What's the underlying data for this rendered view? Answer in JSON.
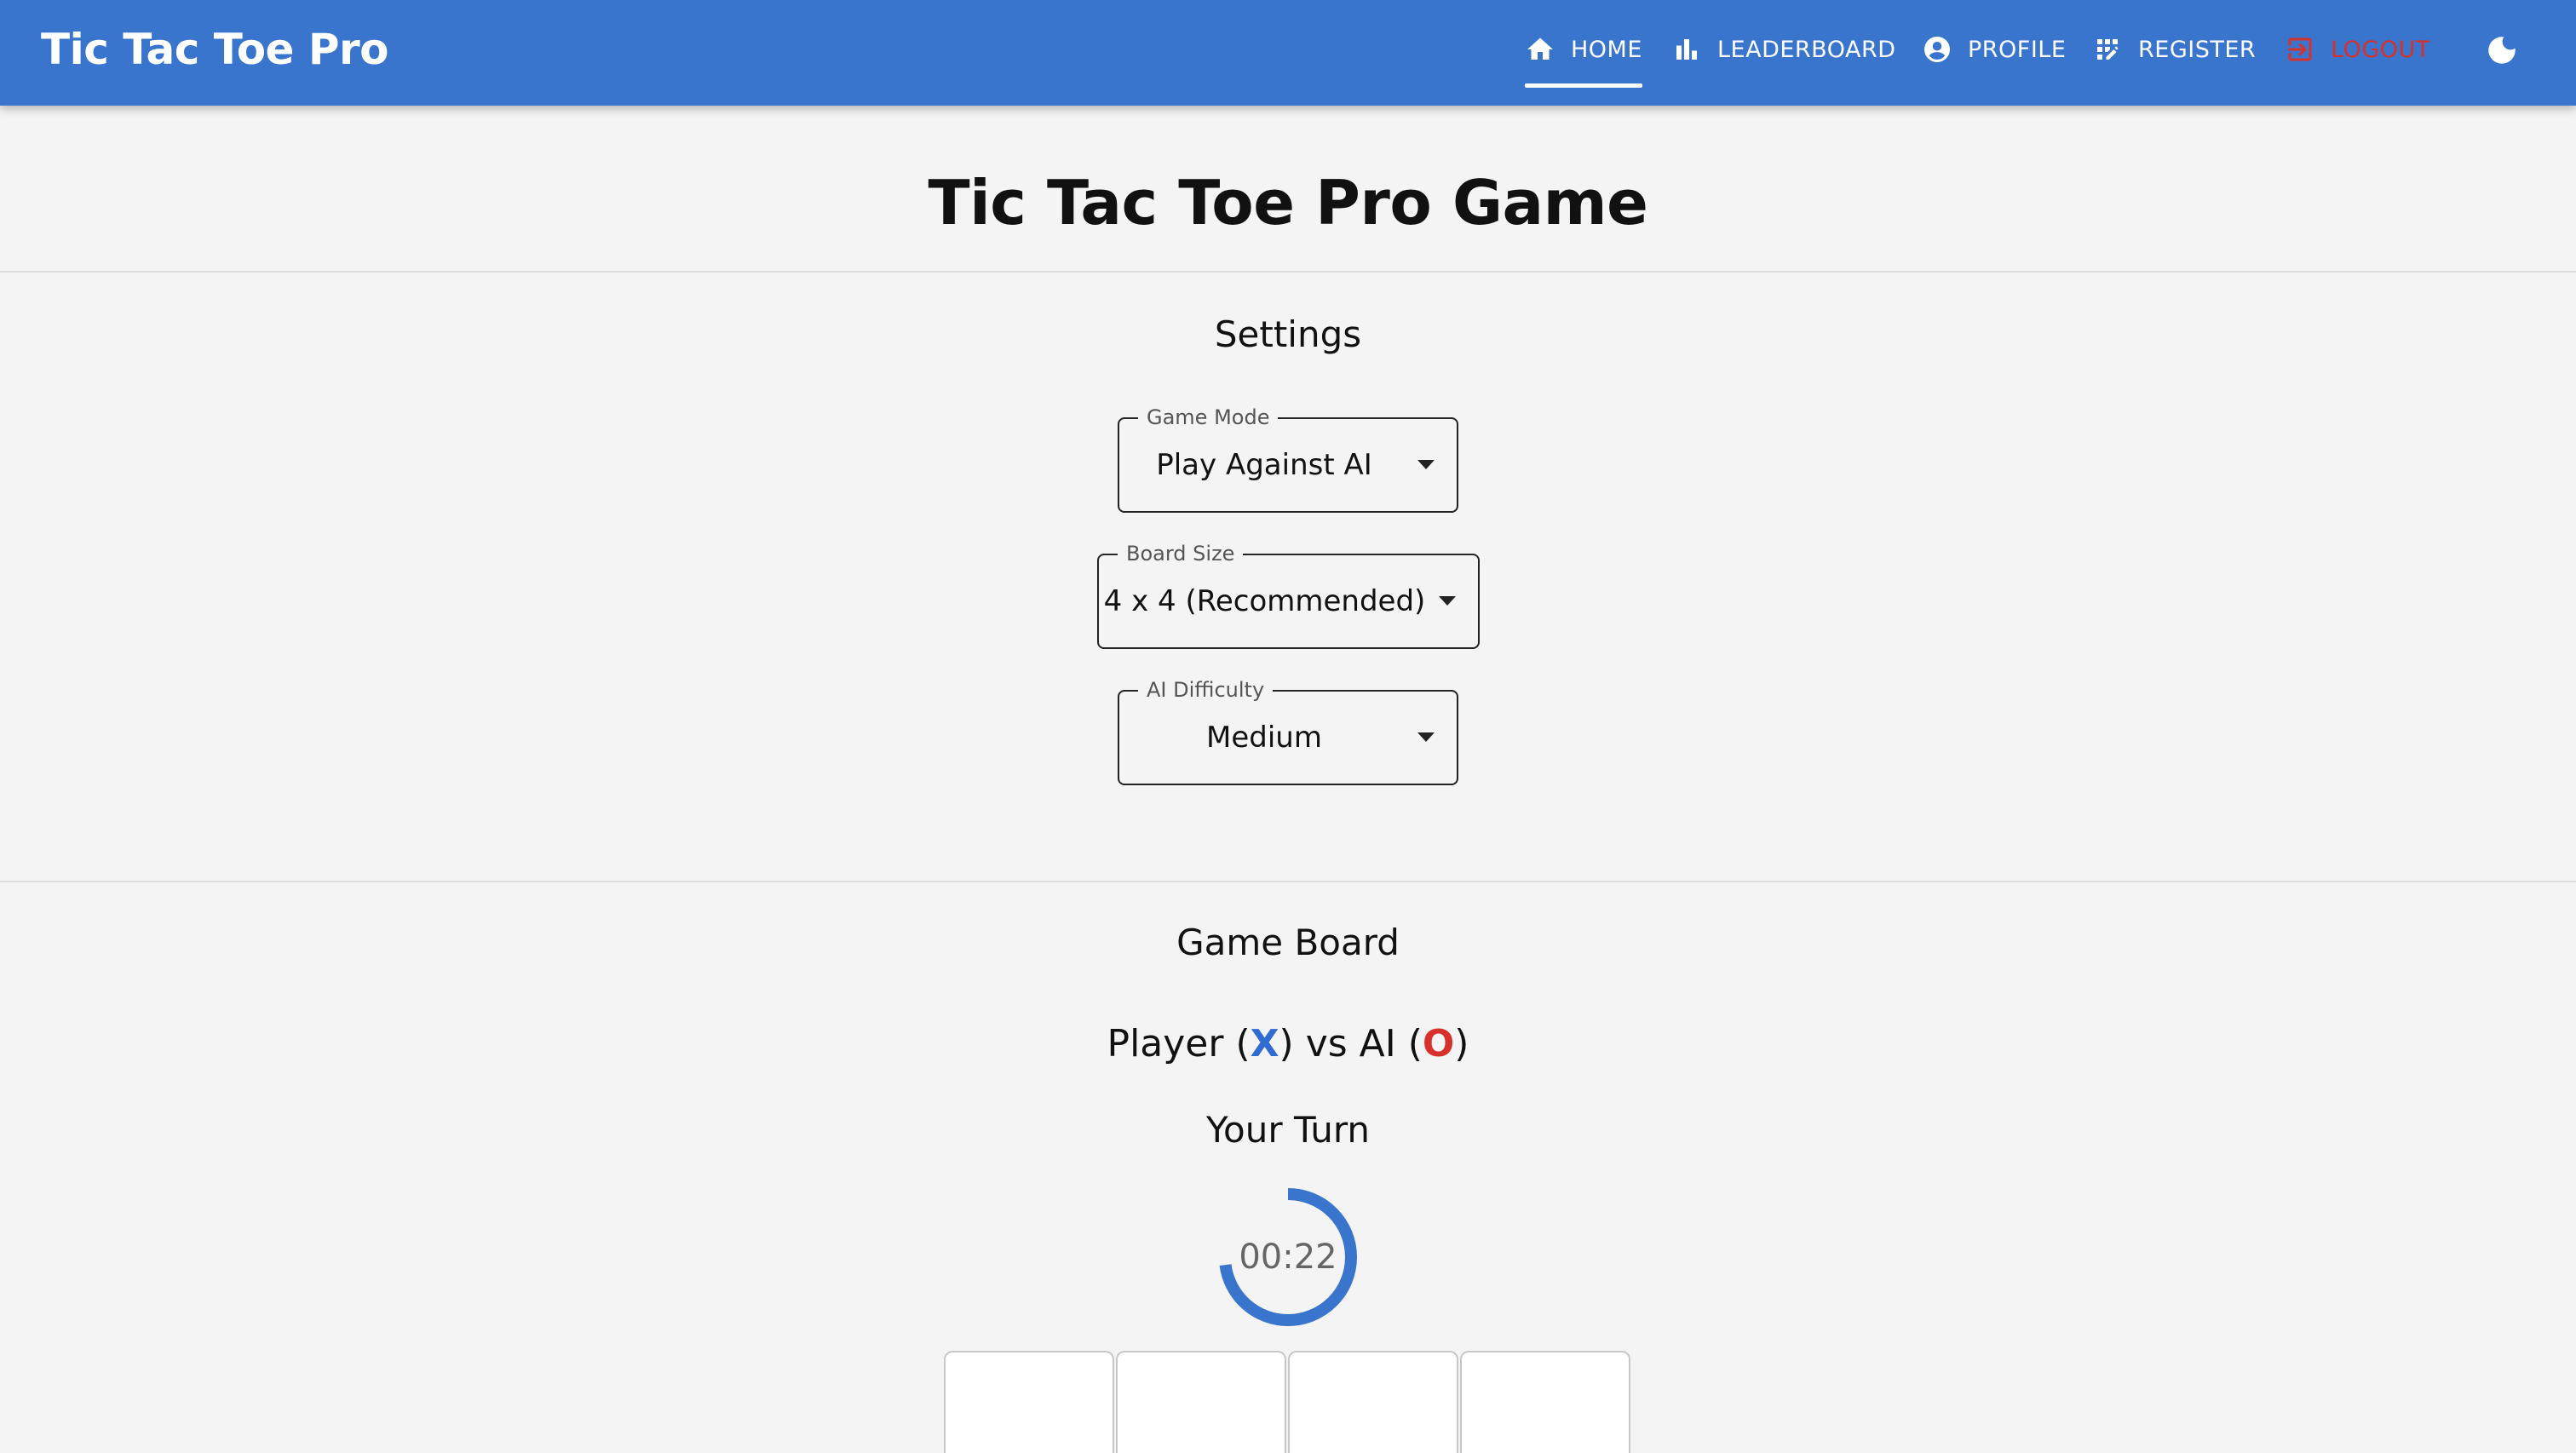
{
  "app": {
    "brand": "Tic Tac Toe Pro",
    "colors": {
      "appbar": "#3a75cd",
      "player_x": "#2f6bd0",
      "player_o": "#d7312c",
      "logout": "#d7312c"
    }
  },
  "nav": {
    "home": {
      "label": "HOME",
      "icon": "home-icon",
      "active": true
    },
    "leaderboard": {
      "label": "LEADERBOARD",
      "icon": "bar-chart-icon"
    },
    "profile": {
      "label": "PROFILE",
      "icon": "account-circle-icon"
    },
    "register": {
      "label": "REGISTER",
      "icon": "app-registration-icon"
    },
    "logout": {
      "label": "LOGOUT",
      "icon": "logout-icon"
    },
    "theme_toggle": {
      "icon": "moon-icon"
    }
  },
  "page": {
    "title": "Tic Tac Toe Pro Game"
  },
  "settings": {
    "heading": "Settings",
    "game_mode": {
      "label": "Game Mode",
      "value": "Play Against AI"
    },
    "board_size": {
      "label": "Board Size",
      "value": "4 x 4 (Recommended)"
    },
    "ai_difficulty": {
      "label": "AI Difficulty",
      "value": "Medium"
    }
  },
  "game": {
    "heading": "Game Board",
    "matchup": {
      "prefix": "Player (",
      "x": "X",
      "middle": ") vs AI (",
      "o": "O",
      "suffix": ")"
    },
    "turn": "Your Turn",
    "timer": {
      "text": "00:22",
      "progress": 0.73
    },
    "board": {
      "size": 4
    }
  }
}
